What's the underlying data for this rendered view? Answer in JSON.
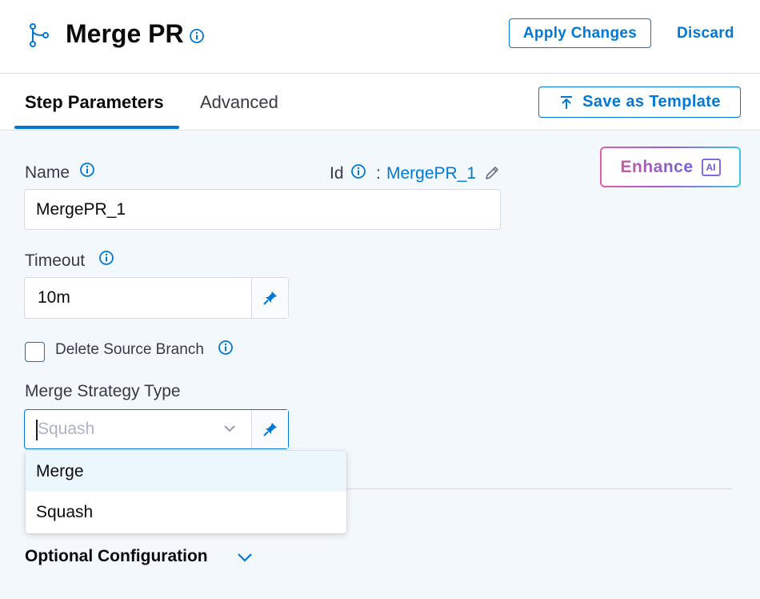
{
  "header": {
    "title": "Merge PR",
    "apply_label": "Apply Changes",
    "discard_label": "Discard"
  },
  "tabs": [
    {
      "label": "Step Parameters",
      "active": true
    },
    {
      "label": "Advanced",
      "active": false
    }
  ],
  "toolbar": {
    "save_template_label": "Save as Template",
    "enhance_label": "Enhance",
    "ai_badge": "AI"
  },
  "form": {
    "name_label": "Name",
    "name_value": "MergePR_1",
    "id_label": "Id",
    "id_colon": ":",
    "id_value": "MergePR_1",
    "timeout_label": "Timeout",
    "timeout_value": "10m",
    "delete_branch_label": "Delete Source Branch",
    "delete_branch_checked": false,
    "strategy_label": "Merge Strategy Type",
    "strategy_placeholder": "Squash",
    "strategy_options": [
      "Merge",
      "Squash"
    ],
    "optional_label": "Optional Configuration"
  },
  "colors": {
    "accent": "#0278d5",
    "page_bg": "#f3f8fc",
    "hover_bg": "#ecf7fd",
    "border": "#d9dae5"
  },
  "icons": {
    "step": "git-merge-icon",
    "info": "info-icon",
    "pencil": "pencil-icon",
    "pin": "pin-icon",
    "chevron": "chevron-down-icon",
    "upload": "upload-icon"
  }
}
